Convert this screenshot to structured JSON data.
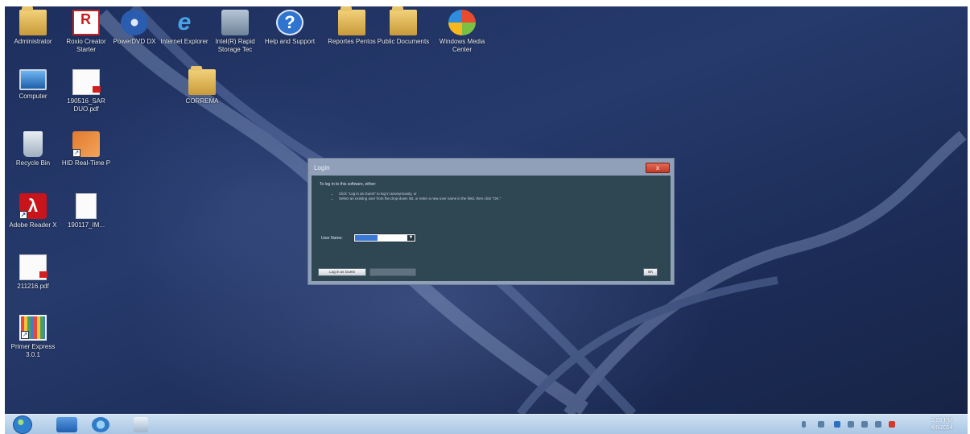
{
  "desktop": {
    "icons": [
      {
        "label": "Administrator",
        "icon": "user-folder-icon"
      },
      {
        "label": "Roxio Creator Starter",
        "icon": "roxio-icon"
      },
      {
        "label": "PowerDVD DX",
        "icon": "powerdvd-icon"
      },
      {
        "label": "Internet Explorer",
        "icon": "internet-explorer-icon"
      },
      {
        "label": "Intel(R) Rapid Storage Tec",
        "icon": "intel-rapid-storage-icon"
      },
      {
        "label": "Help and Support",
        "icon": "help-icon"
      },
      {
        "label": "Reportes Pentos",
        "icon": "folder-icon"
      },
      {
        "label": "Public Documents",
        "icon": "public-documents-icon"
      },
      {
        "label": "Windows Media Center",
        "icon": "windows-media-center-icon"
      },
      {
        "label": "Computer",
        "icon": "computer-icon"
      },
      {
        "label": "190516_SAR DUO.pdf",
        "icon": "pdf-document-icon"
      },
      {
        "label": "CORREMA",
        "icon": "folder-icon"
      },
      {
        "label": "Recycle Bin",
        "icon": "recycle-bin-icon"
      },
      {
        "label": "HID Real-Time P",
        "icon": "hid-realtime-icon"
      },
      {
        "label": "Adobe Reader X",
        "icon": "adobe-reader-icon"
      },
      {
        "label": "190117_IM...",
        "icon": "document-icon"
      },
      {
        "label": "211216.pdf",
        "icon": "pdf-document-icon"
      },
      {
        "label": "Primer Express 3.0.1",
        "icon": "primer-express-icon"
      }
    ]
  },
  "login": {
    "title": "Login",
    "intro": "To log in to this software, either:",
    "bullets": [
      "Click \"Log in as Guest\" to log in anonymously, or",
      "Select an existing user from the drop-down list, or enter a new user name in the field, then click \"OK.\""
    ],
    "user_name_label": "User Name:",
    "user_name_value": "",
    "guest_button": "Log in as Guest",
    "disabled_button": "",
    "ok_button": "OK",
    "close_label": "x"
  },
  "taskbar": {
    "clock_time": "3:56 PM",
    "clock_date": "4/6/2014"
  },
  "colors": {
    "desktop_bg": "#1f3262",
    "dialog_body": "#2f4753",
    "taskbar": "#b7d0ea"
  }
}
